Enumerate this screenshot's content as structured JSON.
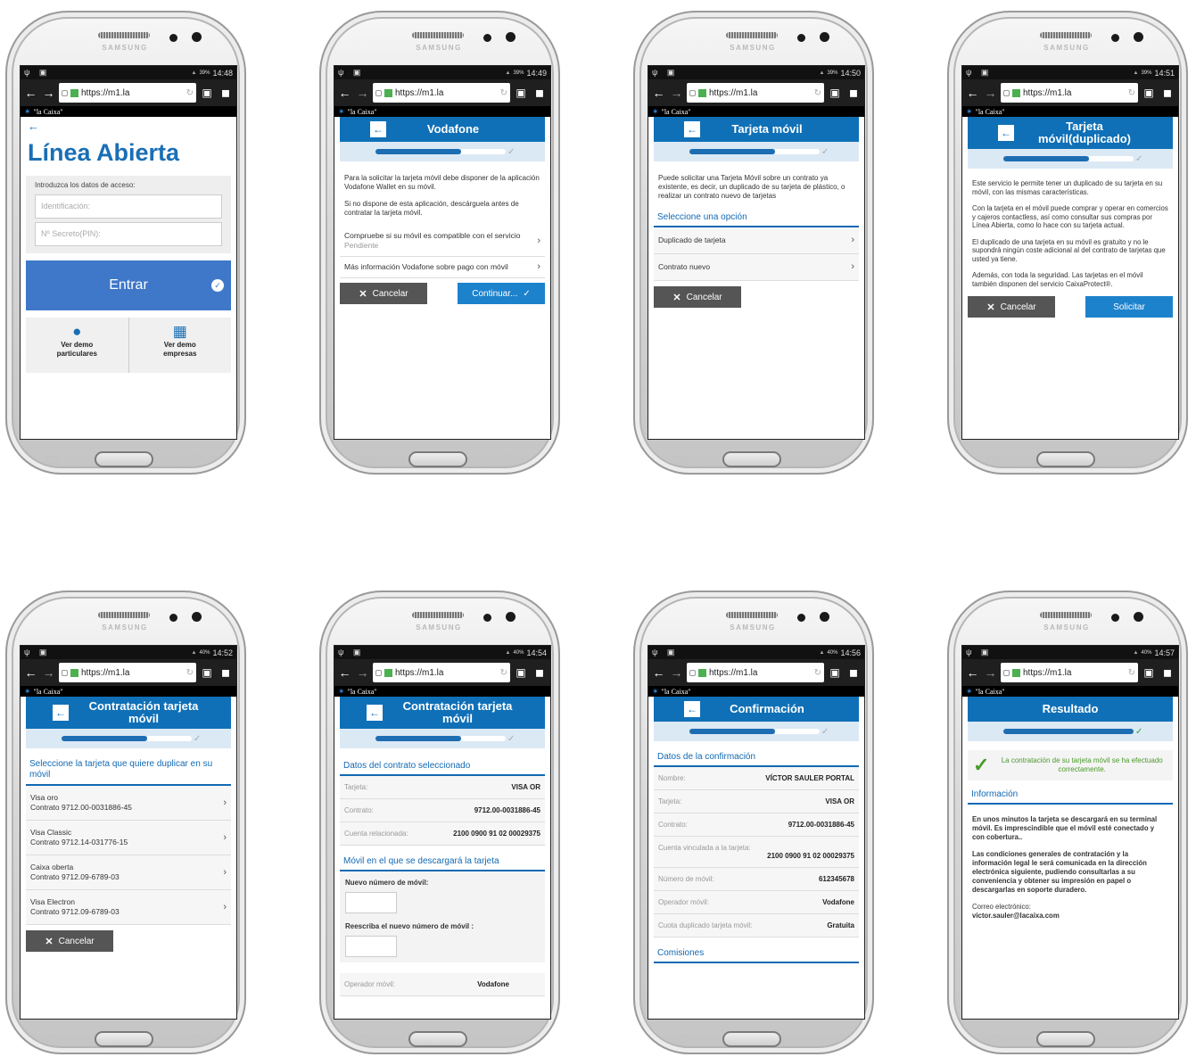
{
  "common": {
    "url": "https://m1.la",
    "logo": "\"la Caixa\"",
    "brand": "SAMSUNG"
  },
  "phones": [
    {
      "time": "14:48",
      "battery": "39%",
      "title": "Línea Abierta",
      "access_label": "Introduzca los datos de acceso:",
      "id_placeholder": "Identificación:",
      "pin_placeholder": "Nº Secreto(PIN):",
      "enter": "Entrar",
      "demo1": "Ver demo particulares",
      "demo2": "Ver demo empresas"
    },
    {
      "time": "14:49",
      "battery": "39%",
      "title": "Vodafone",
      "p1": "Para la solicitar la tarjeta móvil debe disponer de la aplicación Vodafone Wallet en su móvil.",
      "p2": "Si no dispone de esta aplicación, descárguela antes de contratar la tarjeta móvil.",
      "row1": "Compruebe si su móvil es compatible con el servicio",
      "row1_status": "Pendiente",
      "row2": "Más información Vodafone sobre pago con móvil",
      "cancel": "Cancelar",
      "continue": "Continuar..."
    },
    {
      "time": "14:50",
      "battery": "39%",
      "title": "Tarjeta móvil",
      "p1": "Puede solicitar una Tarjeta Móvil sobre un contrato ya existente, es decir, un duplicado de su tarjeta de plástico, o realizar un contrato nuevo de tarjetas",
      "section": "Seleccione una opción",
      "opt1": "Duplicado de tarjeta",
      "opt2": "Contrato nuevo",
      "cancel": "Cancelar"
    },
    {
      "time": "14:51",
      "battery": "39%",
      "title": "Tarjeta móvil(duplicado)",
      "p1": "Este servicio le permite tener un duplicado de su tarjeta en su móvil, con las mismas características.",
      "p2": "Con la tarjeta en el móvil puede comprar y operar en comercios y cajeros contactless, así como consultar sus compras por Línea Abierta, como lo hace con su tarjeta actual.",
      "p3": "El duplicado de una tarjeta en su móvil es gratuito y no le supondrá ningún coste adicional al del contrato de tarjetas que usted ya tiene.",
      "p4": "Además, con toda la seguridad. Las tarjetas en el móvil también disponen del servicio CaixaProtect®.",
      "cancel": "Cancelar",
      "request": "Solicitar"
    },
    {
      "time": "14:52",
      "battery": "40%",
      "title": "Contratación tarjeta móvil",
      "section": "Seleccione la tarjeta que quiere duplicar en su móvil",
      "cards": [
        {
          "name": "Visa oro",
          "contract": "Contrato 9712.00-0031886-45"
        },
        {
          "name": "Visa Classic",
          "contract": "Contrato 9712.14-031776-15"
        },
        {
          "name": "Caixa oberta",
          "contract": "Contrato 9712.09-6789-03"
        },
        {
          "name": "Visa Electron",
          "contract": "Contrato 9712.09-6789-03"
        }
      ],
      "cancel": "Cancelar"
    },
    {
      "time": "14:54",
      "battery": "40%",
      "title": "Contratación tarjeta móvil",
      "section1": "Datos del contrato seleccionado",
      "k1": "Tarjeta:",
      "v1": "VISA OR",
      "k2": "Contrato:",
      "v2": "9712.00-0031886-45",
      "k3": "Cuenta relacionada:",
      "v3": "2100 0900 91 02 00029375",
      "section2": "Móvil en el que se descargará la tarjeta",
      "new_label": "Nuevo número de móvil:",
      "retype_label": "Reescriba el nuevo número de móvil :",
      "k4": "Operador móvil:",
      "v4": "Vodafone"
    },
    {
      "time": "14:56",
      "battery": "40%",
      "title": "Confirmación",
      "section1": "Datos de la confirmación",
      "k1": "Nombre:",
      "v1": "VÍCTOR SAULER PORTAL",
      "k2": "Tarjeta:",
      "v2": "VISA OR",
      "k3": "Contrato:",
      "v3": "9712.00-0031886-45",
      "k4": "Cuenta vinculada a la tarjeta:",
      "v4": "2100 0900 91 02 00029375",
      "k5": "Número de móvil:",
      "v5": "612345678",
      "k6": "Operador móvil:",
      "v6": "Vodafone",
      "k7": "Cuota duplicado tarjeta móvil:",
      "v7": "Gratuita",
      "section2": "Comisiones"
    },
    {
      "time": "14:57",
      "battery": "40%",
      "title": "Resultado",
      "success": "La contratación de su tarjeta móvil se ha efectuado correctamente.",
      "section": "Información",
      "p1": "En unos minutos la tarjeta se descargará en su terminal móvil. Es imprescindible que el móvil esté conectado y con cobertura..",
      "p2": "Las condiciones generales de contratación y la información legal le será comunicada en la dirección electrónica siguiente, pudiendo consultarlas a su conveniencia y obtener su impresión en papel o descargarlas en soporte duradero.",
      "email_label": "Correo electrónico:",
      "email": "victor.sauler@lacaixa.com"
    }
  ]
}
